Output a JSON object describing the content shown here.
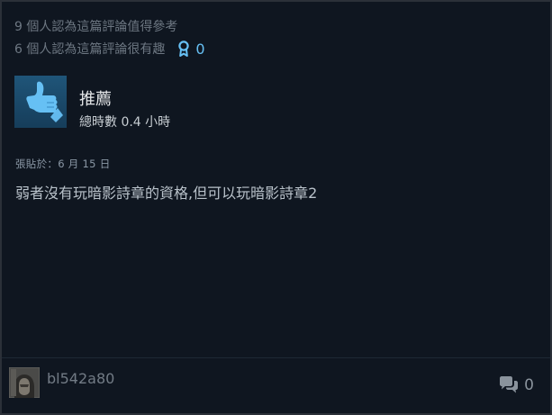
{
  "review": {
    "helpful_line": "9 個人認為這篇評論值得參考",
    "funny_line": "6 個人認為這篇評論很有趣",
    "award_count": "0",
    "recommendation": "推薦",
    "hours": "總時數 0.4 小時",
    "posted": "張貼於：6 月 15 日",
    "text": "弱者沒有玩暗影詩章的資格,但可以玩暗影詩章2"
  },
  "footer": {
    "username": "bl542a80",
    "comment_count": "0"
  },
  "icons": {
    "award": "award-ribbon-icon",
    "thumb": "thumbs-up-icon",
    "comments": "comments-icon"
  },
  "colors": {
    "background": "#0f1620",
    "accent": "#67c1f5",
    "thumb_box": "#1b4b6d",
    "thumb": "#66c0f4"
  }
}
